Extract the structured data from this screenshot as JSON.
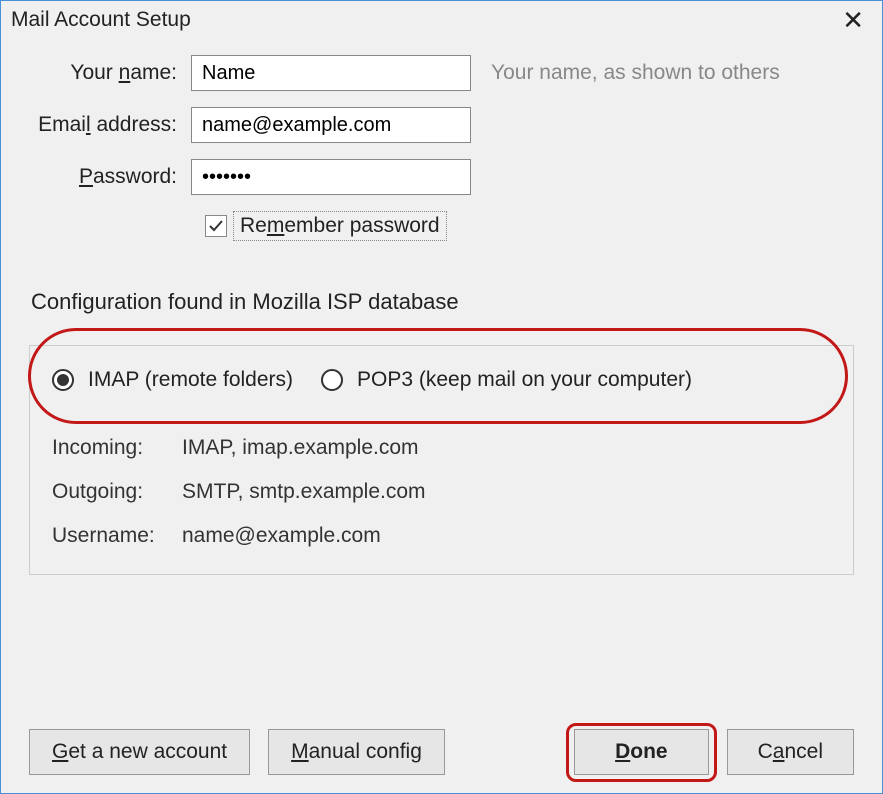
{
  "title": "Mail Account Setup",
  "form": {
    "name_label": "Your name:",
    "name_value": "Name",
    "name_hint": "Your name, as shown to others",
    "email_label": "Email address:",
    "email_value": "name@example.com",
    "password_label": "Password:",
    "password_value": "•••••••",
    "remember_label": "Remember password"
  },
  "status": "Configuration found in Mozilla ISP database",
  "protocol": {
    "imap_label": "IMAP (remote folders)",
    "pop3_label": "POP3 (keep mail on your computer)"
  },
  "config": {
    "incoming_label": "Incoming:",
    "incoming_value": "IMAP, imap.example.com",
    "outgoing_label": "Outgoing:",
    "outgoing_value": "SMTP, smtp.example.com",
    "username_label": "Username:",
    "username_value": "name@example.com"
  },
  "buttons": {
    "get_account": "Get a new account",
    "manual": "Manual config",
    "done": "Done",
    "cancel": "Cancel"
  }
}
